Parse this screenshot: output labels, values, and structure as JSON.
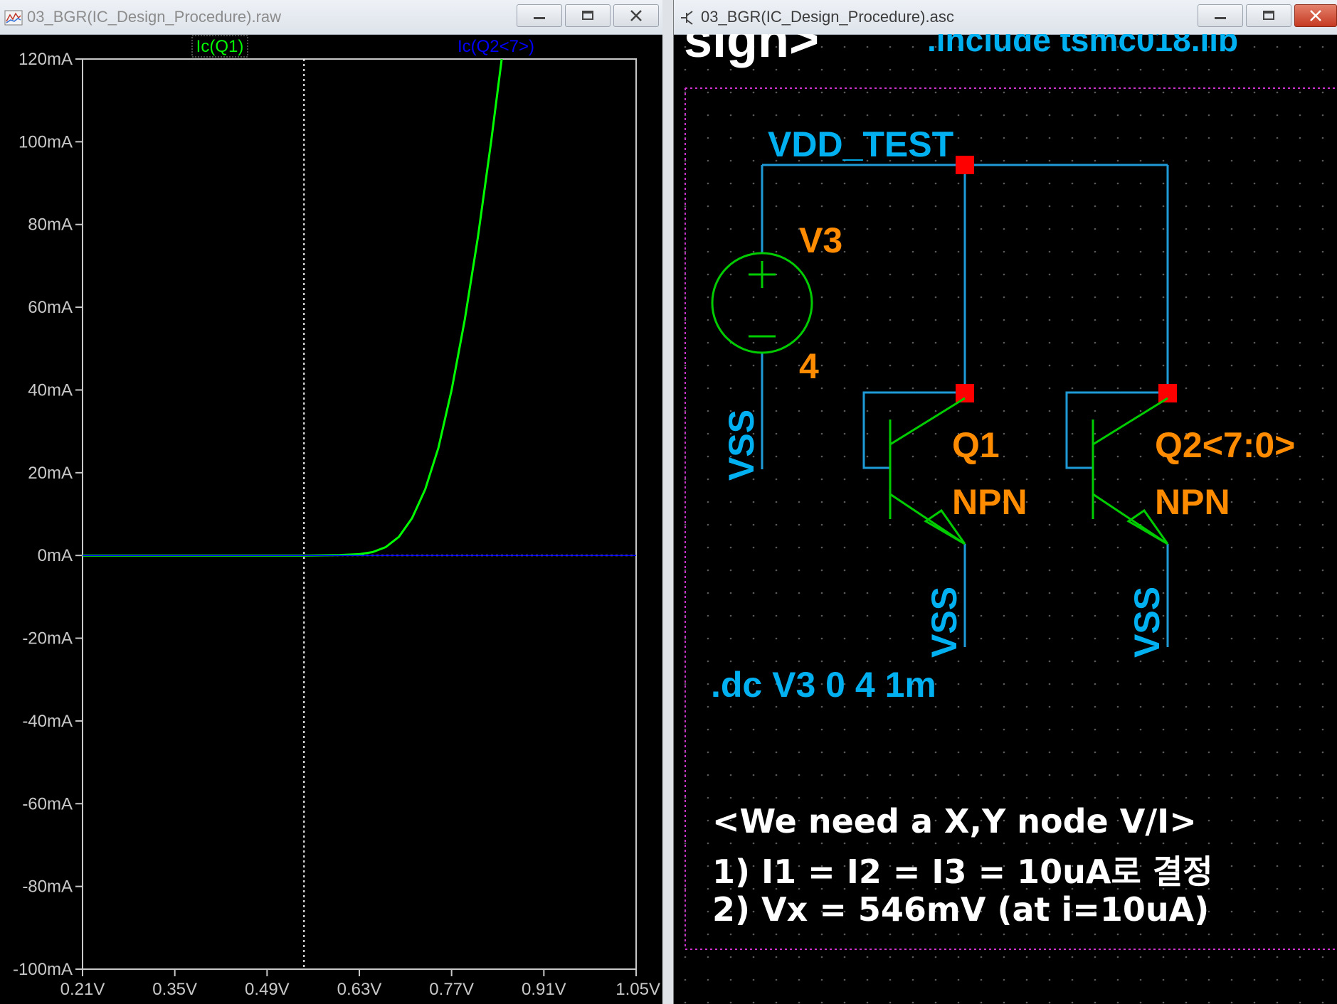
{
  "left_window": {
    "title": "03_BGR(IC_Design_Procedure).raw",
    "trace_labels": [
      {
        "text": "Ic(Q1)",
        "color": "#00ff00"
      },
      {
        "text": "Ic(Q2<7>)",
        "color": "#0000ff"
      }
    ]
  },
  "right_window": {
    "title": "03_BGR(IC_Design_Procedure).asc",
    "include_directive": ".include tsmc018.lib",
    "header_fragment": "sign>",
    "net_vdd": "VDD_TEST",
    "source": {
      "name": "V3",
      "value": "4",
      "plus": "+",
      "minus": "−"
    },
    "ground_labels": [
      "VSS",
      "VSS",
      "VSS"
    ],
    "q1": {
      "name": "Q1",
      "model": "NPN"
    },
    "q2": {
      "name": "Q2<7:0>",
      "model": "NPN"
    },
    "dc_directive": ".dc V3 0 4 1m",
    "notes": [
      "<We need a X,Y node V/I>",
      "1) I1 = I2 = I3 = 10uA로 결정",
      "2) Vx = 546mV (at i=10uA)"
    ],
    "colors": {
      "wire": "#1e9bd7",
      "label": "#00b0f0",
      "orange": "#ff8c00",
      "node": "#ff0000",
      "component": "#00cc00"
    }
  },
  "window_buttons": {
    "minimize": "minimize-icon",
    "maximize": "maximize-icon",
    "close": "close-icon"
  },
  "chart_data": {
    "type": "line",
    "title": "",
    "xlabel": "",
    "ylabel": "",
    "x_ticks": [
      "0.21V",
      "0.35V",
      "0.49V",
      "0.63V",
      "0.77V",
      "0.91V",
      "1.05V"
    ],
    "y_ticks": [
      "120mA",
      "100mA",
      "80mA",
      "60mA",
      "40mA",
      "20mA",
      "0mA",
      "-20mA",
      "-40mA",
      "-60mA",
      "-80mA",
      "-100mA"
    ],
    "xlim": [
      0.21,
      1.05
    ],
    "ylim": [
      -100,
      120
    ],
    "x_unit": "V",
    "y_unit": "mA",
    "cursor_x": 0.546,
    "series": [
      {
        "name": "Ic(Q1)",
        "color": "#00ff00",
        "x": [
          0.21,
          0.4,
          0.5,
          0.55,
          0.6,
          0.63,
          0.65,
          0.67,
          0.69,
          0.71,
          0.73,
          0.75,
          0.77,
          0.79,
          0.81,
          0.83,
          0.846
        ],
        "y": [
          0,
          0,
          0,
          0,
          0.1,
          0.3,
          0.8,
          2,
          4.5,
          9,
          16,
          26,
          40,
          57,
          77,
          100,
          120
        ]
      },
      {
        "name": "Ic(Q2<7>)",
        "color": "#0000ff",
        "x": [
          0.21,
          1.05
        ],
        "y": [
          0,
          0
        ]
      }
    ]
  }
}
